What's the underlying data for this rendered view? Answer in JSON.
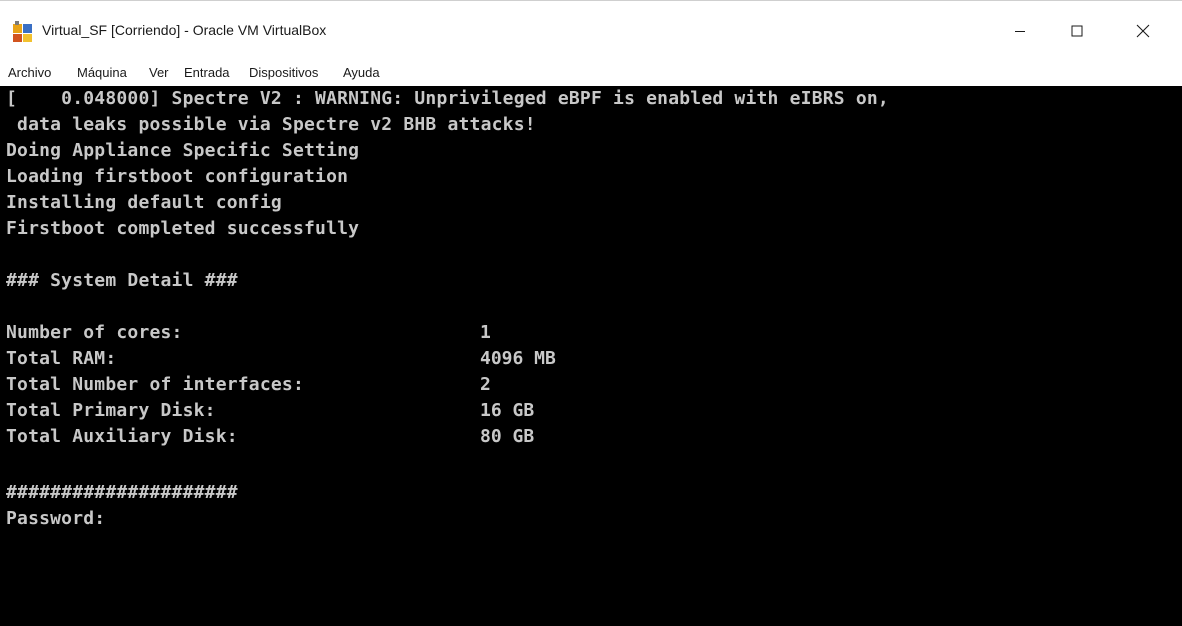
{
  "window": {
    "title": "Virtual_SF [Corriendo] - Oracle VM VirtualBox",
    "app_icon": "virtualbox-icon",
    "controls": [
      "minimize-icon",
      "maximize-icon",
      "close-icon"
    ]
  },
  "menu": {
    "items": [
      "Archivo",
      "Máquina",
      "Ver",
      "Entrada",
      "Dispositivos",
      "Ayuda"
    ]
  },
  "console": {
    "boot_lines": [
      "[    0.048000] Spectre V2 : WARNING: Unprivileged eBPF is enabled with eIBRS on,",
      " data leaks possible via Spectre v2 BHB attacks!",
      "Doing Appliance Specific Setting",
      "Loading firstboot configuration",
      "Installing default config",
      "Firstboot completed successfully"
    ],
    "section_header": "### System Detail ###",
    "details": [
      {
        "label": "Number of cores:",
        "value": "1"
      },
      {
        "label": "Total RAM:",
        "value": "4096 MB"
      },
      {
        "label": "Total Number of interfaces:",
        "value": "2"
      },
      {
        "label": "Total Primary Disk:",
        "value": "16 GB"
      },
      {
        "label": "Total Auxiliary Disk:",
        "value": "80 GB"
      }
    ],
    "separator": "#####################",
    "prompt": "Password:"
  },
  "colors": {
    "console_bg": "#000000",
    "console_fg": "#c8c8c8"
  }
}
